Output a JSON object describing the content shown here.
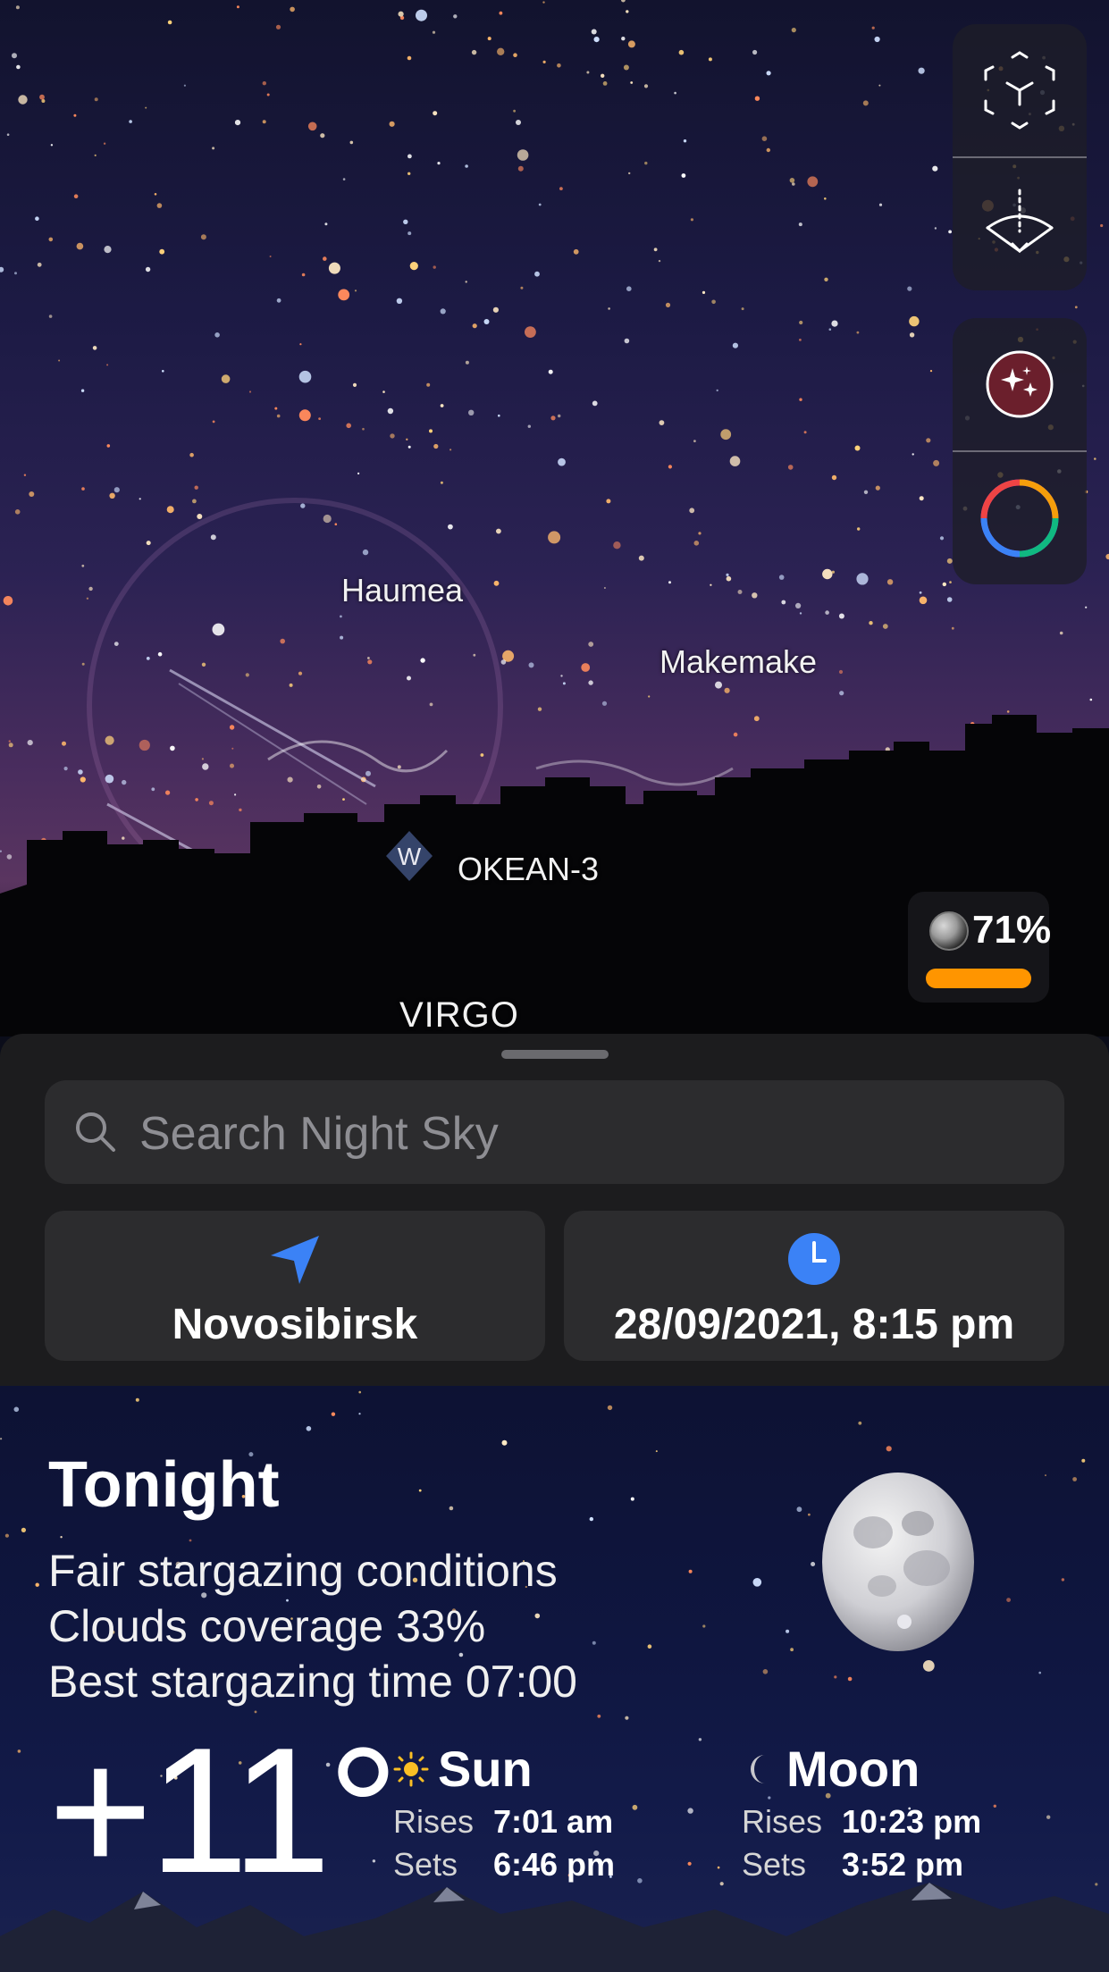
{
  "sky": {
    "labels": {
      "haumea": "Haumea",
      "makemake": "Makemake",
      "satellite": "OKEAN-3",
      "satellite_badge": "W",
      "constellation": "VIRGO"
    }
  },
  "controls": {
    "ar_mode_icon": "ar-cube-icon",
    "horizon_icon": "horizon-view-icon",
    "sky_objects_icon": "stars-icon",
    "color_filter_icon": "color-wheel-icon"
  },
  "moon_phase": {
    "percent_label": "71%",
    "level": 0.71,
    "bar_color": "#ff9500"
  },
  "search": {
    "placeholder": "Search Night Sky"
  },
  "location": {
    "label": "Novosibirsk",
    "icon": "location-arrow-icon"
  },
  "datetime": {
    "label": "28/09/2021, 8:15 pm",
    "icon": "clock-icon"
  },
  "tonight": {
    "title": "Tonight",
    "conditions": [
      "Fair stargazing conditions",
      "Clouds coverage 33%",
      "Best stargazing time 07:00"
    ],
    "temperature": "+11°",
    "sun": {
      "title": "Sun",
      "rises_label": "Rises",
      "rises": "7:01 am",
      "sets_label": "Sets",
      "sets": "6:46 pm"
    },
    "moon": {
      "title": "Moon",
      "rises_label": "Rises",
      "rises": "10:23 pm",
      "sets_label": "Sets",
      "sets": "3:52 pm"
    }
  },
  "colors": {
    "accent_blue": "#3b82f6",
    "phase_orange": "#ff9500",
    "sheet_bg": "#1c1c1e",
    "field_bg": "#2c2c2e"
  }
}
